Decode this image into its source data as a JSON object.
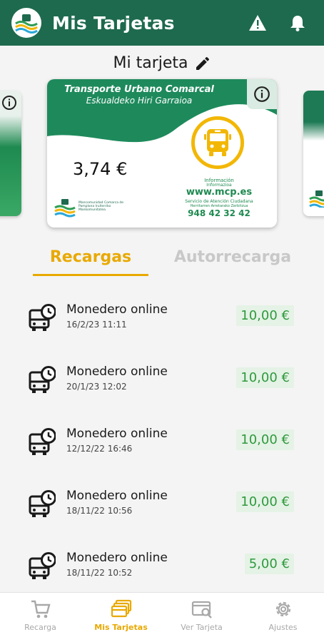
{
  "header": {
    "title": "Mis Tarjetas",
    "warning_icon": "warning-icon",
    "bell_icon": "bell-icon"
  },
  "card_title": "Mi tarjeta",
  "card": {
    "line1": "Transporte Urbano Comarcal",
    "line2": "Eskualdeko Hiri Garraioa",
    "balance": "3,74 €",
    "info_label": "Información",
    "info_label_eu": "Informazioa",
    "website": "www.mcp.es",
    "service_label": "Servicio de Atención Ciudadana",
    "service_label_eu": "Herritarren Arretarako Zerbitzua",
    "phone": "948 42 32 42",
    "issuer_text": "Mancomunidad Comarca de Pamplona Iruñerriko Mankomunitatea"
  },
  "tabs": {
    "active": "Recargas",
    "inactive": "Autorrecarga"
  },
  "transactions": [
    {
      "title": "Monedero online",
      "date": "16/2/23 11:11",
      "amount": "10,00 €"
    },
    {
      "title": "Monedero online",
      "date": "20/1/23 12:02",
      "amount": "10,00 €"
    },
    {
      "title": "Monedero online",
      "date": "12/12/22 16:46",
      "amount": "10,00 €"
    },
    {
      "title": "Monedero online",
      "date": "18/11/22 10:56",
      "amount": "10,00 €"
    },
    {
      "title": "Monedero online",
      "date": "18/11/22 10:52",
      "amount": "5,00 €"
    }
  ],
  "nav": [
    {
      "label": "Recarga",
      "icon": "cart-icon",
      "active": false
    },
    {
      "label": "Mis Tarjetas",
      "icon": "cards-icon",
      "active": true
    },
    {
      "label": "Ver Tarjeta",
      "icon": "card-search-icon",
      "active": false
    },
    {
      "label": "Ajustes",
      "icon": "gear-icon",
      "active": false
    }
  ],
  "colors": {
    "header": "#1e6a4e",
    "accent": "#e8a900",
    "amount_text": "#2e9a3c",
    "amount_bg": "#e5f2e6"
  }
}
